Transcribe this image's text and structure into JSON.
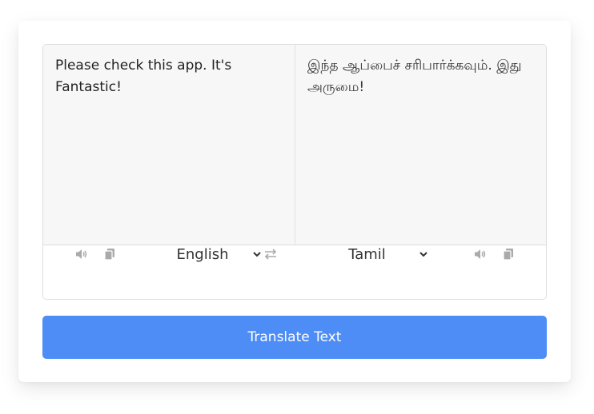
{
  "source": {
    "text": "Please check this app. It's Fantastic!",
    "language": "English"
  },
  "target": {
    "text": "இந்த ஆப்பைச் சரிபார்க்கவும். இது அருமை!",
    "language": "Tamil"
  },
  "controls": {
    "translate_label": "Translate Text"
  },
  "icons": {
    "speaker": "volume-icon",
    "copy": "copy-icon",
    "exchange": "exchange-icon",
    "chevron": "chevron-down-icon"
  },
  "colors": {
    "accent": "#4d8df5",
    "panel_bg": "#f7f7f7",
    "icon": "#aaaaaa"
  }
}
